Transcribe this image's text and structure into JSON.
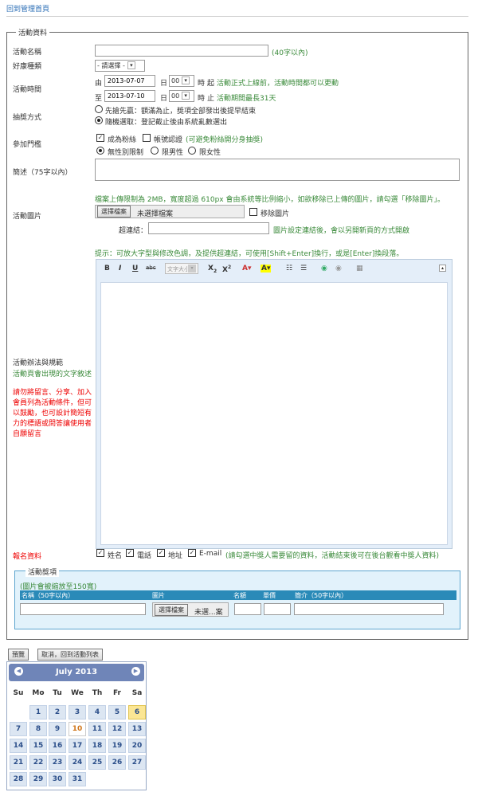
{
  "back_link": "回到管理首頁",
  "fieldset_legend": "活動資料",
  "name": {
    "label": "活動名稱",
    "value": "",
    "hint": "(40字以內)"
  },
  "kind": {
    "label": "好康種類",
    "selected": "- 請選擇 -"
  },
  "time": {
    "label": "活動時間",
    "start_prefix": "由",
    "start_date": "2013-07-07",
    "start_day": "日",
    "start_hour": "00",
    "start_hour_unit": "時",
    "start_note_a": "起",
    "start_note_b": "活動正式上線前，活動時間都可以更動",
    "end_prefix": "至",
    "end_date": "2013-07-10",
    "end_day": "日",
    "end_hour": "00",
    "end_hour_unit": "時",
    "end_note_a": "止",
    "end_note_b": "活動期間最長31天"
  },
  "draw": {
    "label": "抽獎方式",
    "options": [
      "先搶先贏：額滿為止，獎項全部發出後提早結束",
      "隨機選取：登記截止後由系統亂數選出"
    ],
    "selected": 1
  },
  "threshold": {
    "label": "參加門檻",
    "fan": "成為粉絲",
    "verify": "帳號認證",
    "verify_note": "(可避免粉絲開分身抽獎)",
    "genders": [
      "無性別限制",
      "限男性",
      "限女性"
    ],
    "gender_selected": 0
  },
  "summary": {
    "label": "簡述（75字以內）"
  },
  "image": {
    "note": "檔案上傳限制為 2MB，寬度超過 610px 會由系統等比例縮小，如欲移除已上傳的圖片，請勾選「移除圖片」。",
    "label": "活動圖片",
    "choose_button": "選擇檔案",
    "no_file": "未選擇檔案",
    "remove": "移除圖片",
    "link_label": "超連結：",
    "link_value": "",
    "link_note": "圖片設定連結後，會以另開新頁的方式開啟"
  },
  "tip": "提示：可放大字型與修改色調，及提供超連結，可使用[Shift+Enter]換行，或是[Enter]換段落。",
  "editor": {
    "font_size_label": "文字大小"
  },
  "rules": {
    "label": "活動辦法與規範",
    "sub": "活動頁會出現的文字敘述",
    "warning": "請勿將留言、分享、加入會員列為活動條件，但可以鼓勵，也可設計簡短有力的標語或問答讓使用者自願留言"
  },
  "signup": {
    "label": "報名資料",
    "fields": [
      "姓名",
      "電話",
      "地址",
      "E-mail"
    ],
    "note": "(請勾選中獎人需要留的資料，活動結束後可在後台觀看中獎人資料)"
  },
  "prizes": {
    "legend": "活動獎項",
    "note": "(圖片會被縮放至150寬)",
    "columns": [
      "名稱（50字以內）",
      "圖片",
      "名額",
      "單價",
      "簡介（50字以內）"
    ],
    "choose_button": "選擇檔案",
    "no_file": "未選...案"
  },
  "actions": {
    "preview": "預覽",
    "cancel": "取消，回到活動列表"
  },
  "calendar": {
    "title": "July 2013",
    "weekdays": [
      "Su",
      "Mo",
      "Tu",
      "We",
      "Th",
      "Fr",
      "Sa"
    ],
    "start_offset": 1,
    "days_in_month": 31,
    "selected_day": 6,
    "today_day": 10,
    "prev": "◀",
    "next": "▶"
  },
  "colors": {
    "accent_link": "#2a6db5",
    "hint_green": "#3a8a3a",
    "warning_red": "#ee0000",
    "calendar_header": "#6f85b8"
  }
}
